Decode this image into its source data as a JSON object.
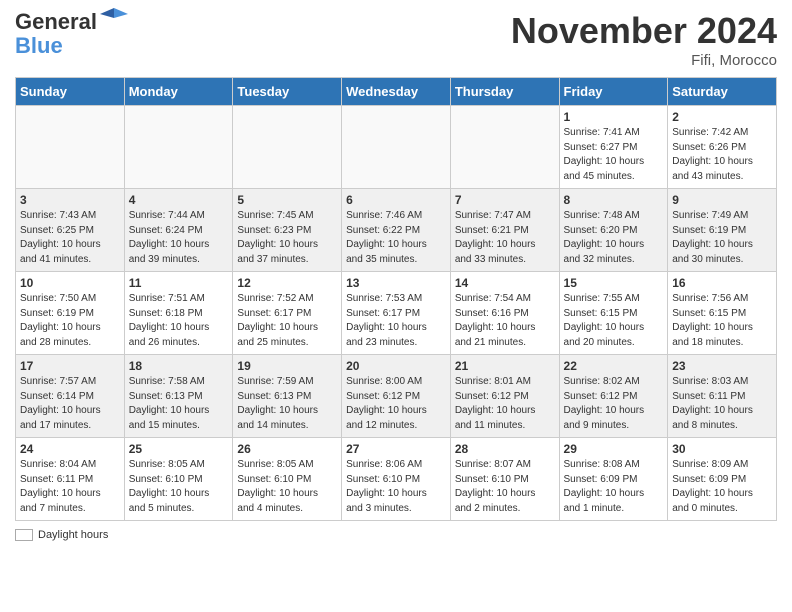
{
  "header": {
    "logo_line1": "General",
    "logo_line2": "Blue",
    "month_title": "November 2024",
    "location": "Fifi, Morocco"
  },
  "weekdays": [
    "Sunday",
    "Monday",
    "Tuesday",
    "Wednesday",
    "Thursday",
    "Friday",
    "Saturday"
  ],
  "legend": {
    "label": "Daylight hours"
  },
  "weeks": [
    [
      {
        "day": "",
        "empty": true
      },
      {
        "day": "",
        "empty": true
      },
      {
        "day": "",
        "empty": true
      },
      {
        "day": "",
        "empty": true
      },
      {
        "day": "",
        "empty": true
      },
      {
        "day": "1",
        "sunrise": "7:41 AM",
        "sunset": "6:27 PM",
        "daylight": "10 hours and 45 minutes."
      },
      {
        "day": "2",
        "sunrise": "7:42 AM",
        "sunset": "6:26 PM",
        "daylight": "10 hours and 43 minutes."
      }
    ],
    [
      {
        "day": "3",
        "sunrise": "7:43 AM",
        "sunset": "6:25 PM",
        "daylight": "10 hours and 41 minutes."
      },
      {
        "day": "4",
        "sunrise": "7:44 AM",
        "sunset": "6:24 PM",
        "daylight": "10 hours and 39 minutes."
      },
      {
        "day": "5",
        "sunrise": "7:45 AM",
        "sunset": "6:23 PM",
        "daylight": "10 hours and 37 minutes."
      },
      {
        "day": "6",
        "sunrise": "7:46 AM",
        "sunset": "6:22 PM",
        "daylight": "10 hours and 35 minutes."
      },
      {
        "day": "7",
        "sunrise": "7:47 AM",
        "sunset": "6:21 PM",
        "daylight": "10 hours and 33 minutes."
      },
      {
        "day": "8",
        "sunrise": "7:48 AM",
        "sunset": "6:20 PM",
        "daylight": "10 hours and 32 minutes."
      },
      {
        "day": "9",
        "sunrise": "7:49 AM",
        "sunset": "6:19 PM",
        "daylight": "10 hours and 30 minutes."
      }
    ],
    [
      {
        "day": "10",
        "sunrise": "7:50 AM",
        "sunset": "6:19 PM",
        "daylight": "10 hours and 28 minutes."
      },
      {
        "day": "11",
        "sunrise": "7:51 AM",
        "sunset": "6:18 PM",
        "daylight": "10 hours and 26 minutes."
      },
      {
        "day": "12",
        "sunrise": "7:52 AM",
        "sunset": "6:17 PM",
        "daylight": "10 hours and 25 minutes."
      },
      {
        "day": "13",
        "sunrise": "7:53 AM",
        "sunset": "6:17 PM",
        "daylight": "10 hours and 23 minutes."
      },
      {
        "day": "14",
        "sunrise": "7:54 AM",
        "sunset": "6:16 PM",
        "daylight": "10 hours and 21 minutes."
      },
      {
        "day": "15",
        "sunrise": "7:55 AM",
        "sunset": "6:15 PM",
        "daylight": "10 hours and 20 minutes."
      },
      {
        "day": "16",
        "sunrise": "7:56 AM",
        "sunset": "6:15 PM",
        "daylight": "10 hours and 18 minutes."
      }
    ],
    [
      {
        "day": "17",
        "sunrise": "7:57 AM",
        "sunset": "6:14 PM",
        "daylight": "10 hours and 17 minutes."
      },
      {
        "day": "18",
        "sunrise": "7:58 AM",
        "sunset": "6:13 PM",
        "daylight": "10 hours and 15 minutes."
      },
      {
        "day": "19",
        "sunrise": "7:59 AM",
        "sunset": "6:13 PM",
        "daylight": "10 hours and 14 minutes."
      },
      {
        "day": "20",
        "sunrise": "8:00 AM",
        "sunset": "6:12 PM",
        "daylight": "10 hours and 12 minutes."
      },
      {
        "day": "21",
        "sunrise": "8:01 AM",
        "sunset": "6:12 PM",
        "daylight": "10 hours and 11 minutes."
      },
      {
        "day": "22",
        "sunrise": "8:02 AM",
        "sunset": "6:12 PM",
        "daylight": "10 hours and 9 minutes."
      },
      {
        "day": "23",
        "sunrise": "8:03 AM",
        "sunset": "6:11 PM",
        "daylight": "10 hours and 8 minutes."
      }
    ],
    [
      {
        "day": "24",
        "sunrise": "8:04 AM",
        "sunset": "6:11 PM",
        "daylight": "10 hours and 7 minutes."
      },
      {
        "day": "25",
        "sunrise": "8:05 AM",
        "sunset": "6:10 PM",
        "daylight": "10 hours and 5 minutes."
      },
      {
        "day": "26",
        "sunrise": "8:05 AM",
        "sunset": "6:10 PM",
        "daylight": "10 hours and 4 minutes."
      },
      {
        "day": "27",
        "sunrise": "8:06 AM",
        "sunset": "6:10 PM",
        "daylight": "10 hours and 3 minutes."
      },
      {
        "day": "28",
        "sunrise": "8:07 AM",
        "sunset": "6:10 PM",
        "daylight": "10 hours and 2 minutes."
      },
      {
        "day": "29",
        "sunrise": "8:08 AM",
        "sunset": "6:09 PM",
        "daylight": "10 hours and 1 minute."
      },
      {
        "day": "30",
        "sunrise": "8:09 AM",
        "sunset": "6:09 PM",
        "daylight": "10 hours and 0 minutes."
      }
    ]
  ]
}
